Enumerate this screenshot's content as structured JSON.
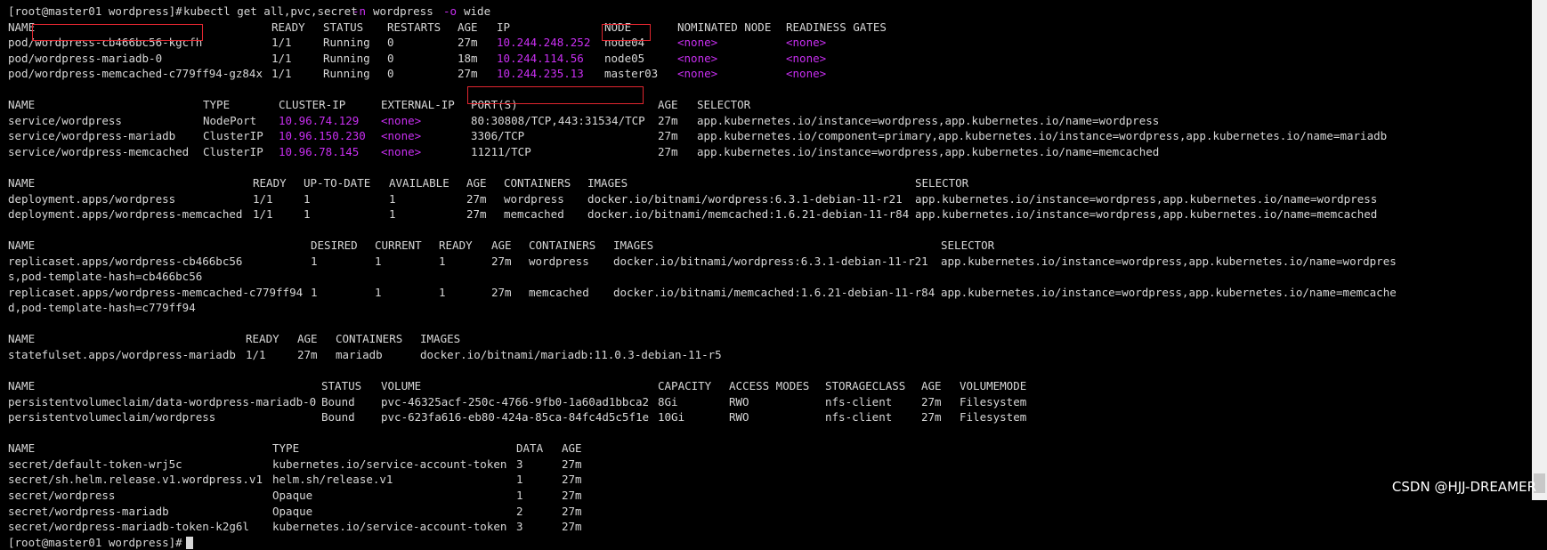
{
  "prompt": "[root@master01 wordpress]#",
  "command": {
    "cmd": "kubectl get all,pvc,secret",
    "flag1": "-n",
    "ns": "wordpress",
    "flag2": "-o",
    "fmt": "wide"
  },
  "pods": {
    "headers": [
      "NAME",
      "READY",
      "STATUS",
      "RESTARTS",
      "AGE",
      "IP",
      "NODE",
      "NOMINATED NODE",
      "READINESS GATES"
    ],
    "rows": [
      [
        "pod/wordpress-cb466bc56-kgcfh",
        "1/1",
        "Running",
        "0",
        "27m",
        "10.244.248.252",
        "node04",
        "<none>",
        "<none>"
      ],
      [
        "pod/wordpress-mariadb-0",
        "1/1",
        "Running",
        "0",
        "18m",
        "10.244.114.56",
        "node05",
        "<none>",
        "<none>"
      ],
      [
        "pod/wordpress-memcached-c779ff94-gz84x",
        "1/1",
        "Running",
        "0",
        "27m",
        "10.244.235.13",
        "master03",
        "<none>",
        "<none>"
      ]
    ]
  },
  "services": {
    "headers": [
      "NAME",
      "TYPE",
      "CLUSTER-IP",
      "EXTERNAL-IP",
      "PORT(S)",
      "AGE",
      "SELECTOR"
    ],
    "rows": [
      [
        "service/wordpress",
        "NodePort",
        "10.96.74.129",
        "<none>",
        "80:30808/TCP,443:31534/TCP",
        "27m",
        "app.kubernetes.io/instance=wordpress,app.kubernetes.io/name=wordpress"
      ],
      [
        "service/wordpress-mariadb",
        "ClusterIP",
        "10.96.150.230",
        "<none>",
        "3306/TCP",
        "27m",
        "app.kubernetes.io/component=primary,app.kubernetes.io/instance=wordpress,app.kubernetes.io/name=mariadb"
      ],
      [
        "service/wordpress-memcached",
        "ClusterIP",
        "10.96.78.145",
        "<none>",
        "11211/TCP",
        "27m",
        "app.kubernetes.io/instance=wordpress,app.kubernetes.io/name=memcached"
      ]
    ]
  },
  "deployments": {
    "headers": [
      "NAME",
      "READY",
      "UP-TO-DATE",
      "AVAILABLE",
      "AGE",
      "CONTAINERS",
      "IMAGES",
      "SELECTOR"
    ],
    "rows": [
      [
        "deployment.apps/wordpress",
        "1/1",
        "1",
        "1",
        "27m",
        "wordpress",
        "docker.io/bitnami/wordpress:6.3.1-debian-11-r21",
        "app.kubernetes.io/instance=wordpress,app.kubernetes.io/name=wordpress"
      ],
      [
        "deployment.apps/wordpress-memcached",
        "1/1",
        "1",
        "1",
        "27m",
        "memcached",
        "docker.io/bitnami/memcached:1.6.21-debian-11-r84",
        "app.kubernetes.io/instance=wordpress,app.kubernetes.io/name=memcached"
      ]
    ]
  },
  "replicasets": {
    "headers": [
      "NAME",
      "DESIRED",
      "CURRENT",
      "READY",
      "AGE",
      "CONTAINERS",
      "IMAGES",
      "SELECTOR"
    ],
    "rows": [
      [
        "replicaset.apps/wordpress-cb466bc56",
        "1",
        "1",
        "1",
        "27m",
        "wordpress",
        "docker.io/bitnami/wordpress:6.3.1-debian-11-r21",
        "app.kubernetes.io/instance=wordpress,app.kubernetes.io/name=wordpres",
        "s,pod-template-hash=cb466bc56"
      ],
      [
        "replicaset.apps/wordpress-memcached-c779ff94",
        "1",
        "1",
        "1",
        "27m",
        "memcached",
        "docker.io/bitnami/memcached:1.6.21-debian-11-r84",
        "app.kubernetes.io/instance=wordpress,app.kubernetes.io/name=memcache",
        "d,pod-template-hash=c779ff94"
      ]
    ]
  },
  "statefulsets": {
    "headers": [
      "NAME",
      "READY",
      "AGE",
      "CONTAINERS",
      "IMAGES"
    ],
    "rows": [
      [
        "statefulset.apps/wordpress-mariadb",
        "1/1",
        "27m",
        "mariadb",
        "docker.io/bitnami/mariadb:11.0.3-debian-11-r5"
      ]
    ]
  },
  "pvcs": {
    "headers": [
      "NAME",
      "STATUS",
      "VOLUME",
      "CAPACITY",
      "ACCESS MODES",
      "STORAGECLASS",
      "AGE",
      "VOLUMEMODE"
    ],
    "rows": [
      [
        "persistentvolumeclaim/data-wordpress-mariadb-0",
        "Bound",
        "pvc-46325acf-250c-4766-9fb0-1a60ad1bbca2",
        "8Gi",
        "RWO",
        "nfs-client",
        "27m",
        "Filesystem"
      ],
      [
        "persistentvolumeclaim/wordpress",
        "Bound",
        "pvc-623fa616-eb80-424a-85ca-84fc4d5c5f1e",
        "10Gi",
        "RWO",
        "nfs-client",
        "27m",
        "Filesystem"
      ]
    ]
  },
  "secrets": {
    "headers": [
      "NAME",
      "TYPE",
      "DATA",
      "AGE"
    ],
    "rows": [
      [
        "secret/default-token-wrj5c",
        "kubernetes.io/service-account-token",
        "3",
        "27m"
      ],
      [
        "secret/sh.helm.release.v1.wordpress.v1",
        "helm.sh/release.v1",
        "1",
        "27m"
      ],
      [
        "secret/wordpress",
        "Opaque",
        "1",
        "27m"
      ],
      [
        "secret/wordpress-mariadb",
        "Opaque",
        "2",
        "27m"
      ],
      [
        "secret/wordpress-mariadb-token-k2g6l",
        "kubernetes.io/service-account-token",
        "3",
        "27m"
      ]
    ]
  },
  "watermark": "CSDN @HJJ-DREAMER",
  "colors": {
    "background": "#000000",
    "text": "#d7d7d7",
    "highlight": "#c92ff2",
    "annotation_box": "#e0262f"
  }
}
